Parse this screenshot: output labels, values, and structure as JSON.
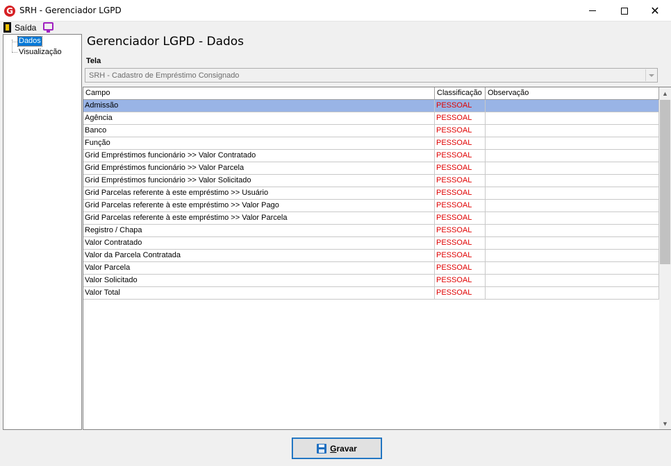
{
  "window": {
    "app_icon_letter": "G",
    "title": "SRH - Gerenciador LGPD"
  },
  "menu": {
    "exit_label": "Saída"
  },
  "tree": {
    "items": [
      {
        "label": "Dados",
        "selected": true
      },
      {
        "label": "Visualização",
        "selected": false
      }
    ]
  },
  "main": {
    "heading": "Gerenciador LGPD - Dados",
    "tela_label": "Tela",
    "tela_value": "SRH - Cadastro de Empréstimo Consignado"
  },
  "grid": {
    "columns": [
      "Campo",
      "Classificação",
      "Observação"
    ],
    "rows": [
      {
        "campo": "Admissão",
        "classificacao": "PESSOAL",
        "observacao": ""
      },
      {
        "campo": "Agência",
        "classificacao": "PESSOAL",
        "observacao": ""
      },
      {
        "campo": "Banco",
        "classificacao": "PESSOAL",
        "observacao": ""
      },
      {
        "campo": "Função",
        "classificacao": "PESSOAL",
        "observacao": ""
      },
      {
        "campo": "Grid Empréstimos funcionário >> Valor Contratado",
        "classificacao": "PESSOAL",
        "observacao": ""
      },
      {
        "campo": "Grid Empréstimos funcionário >> Valor Parcela",
        "classificacao": "PESSOAL",
        "observacao": ""
      },
      {
        "campo": "Grid Empréstimos funcionário >> Valor Solicitado",
        "classificacao": "PESSOAL",
        "observacao": ""
      },
      {
        "campo": "Grid Parcelas referente à este empréstimo >> Usuário",
        "classificacao": "PESSOAL",
        "observacao": ""
      },
      {
        "campo": "Grid Parcelas referente à este empréstimo >> Valor Pago",
        "classificacao": "PESSOAL",
        "observacao": ""
      },
      {
        "campo": "Grid Parcelas referente à este empréstimo >> Valor Parcela",
        "classificacao": "PESSOAL",
        "observacao": ""
      },
      {
        "campo": "Registro / Chapa",
        "classificacao": "PESSOAL",
        "observacao": ""
      },
      {
        "campo": "Valor Contratado",
        "classificacao": "PESSOAL",
        "observacao": ""
      },
      {
        "campo": "Valor da Parcela Contratada",
        "classificacao": "PESSOAL",
        "observacao": ""
      },
      {
        "campo": "Valor Parcela",
        "classificacao": "PESSOAL",
        "observacao": ""
      },
      {
        "campo": "Valor Solicitado",
        "classificacao": "PESSOAL",
        "observacao": ""
      },
      {
        "campo": "Valor Total",
        "classificacao": "PESSOAL",
        "observacao": ""
      }
    ],
    "selected_row": 0
  },
  "footer": {
    "save_label_first": "G",
    "save_label_rest": "ravar"
  },
  "colors": {
    "selection_row": "#99b4e6",
    "classification_text": "#e00000",
    "tree_selection": "#0078d7"
  },
  "icons": {
    "app": "srh-logo-icon",
    "exit": "exit-door-icon",
    "monitor": "monitor-icon",
    "save": "floppy-disk-icon"
  }
}
